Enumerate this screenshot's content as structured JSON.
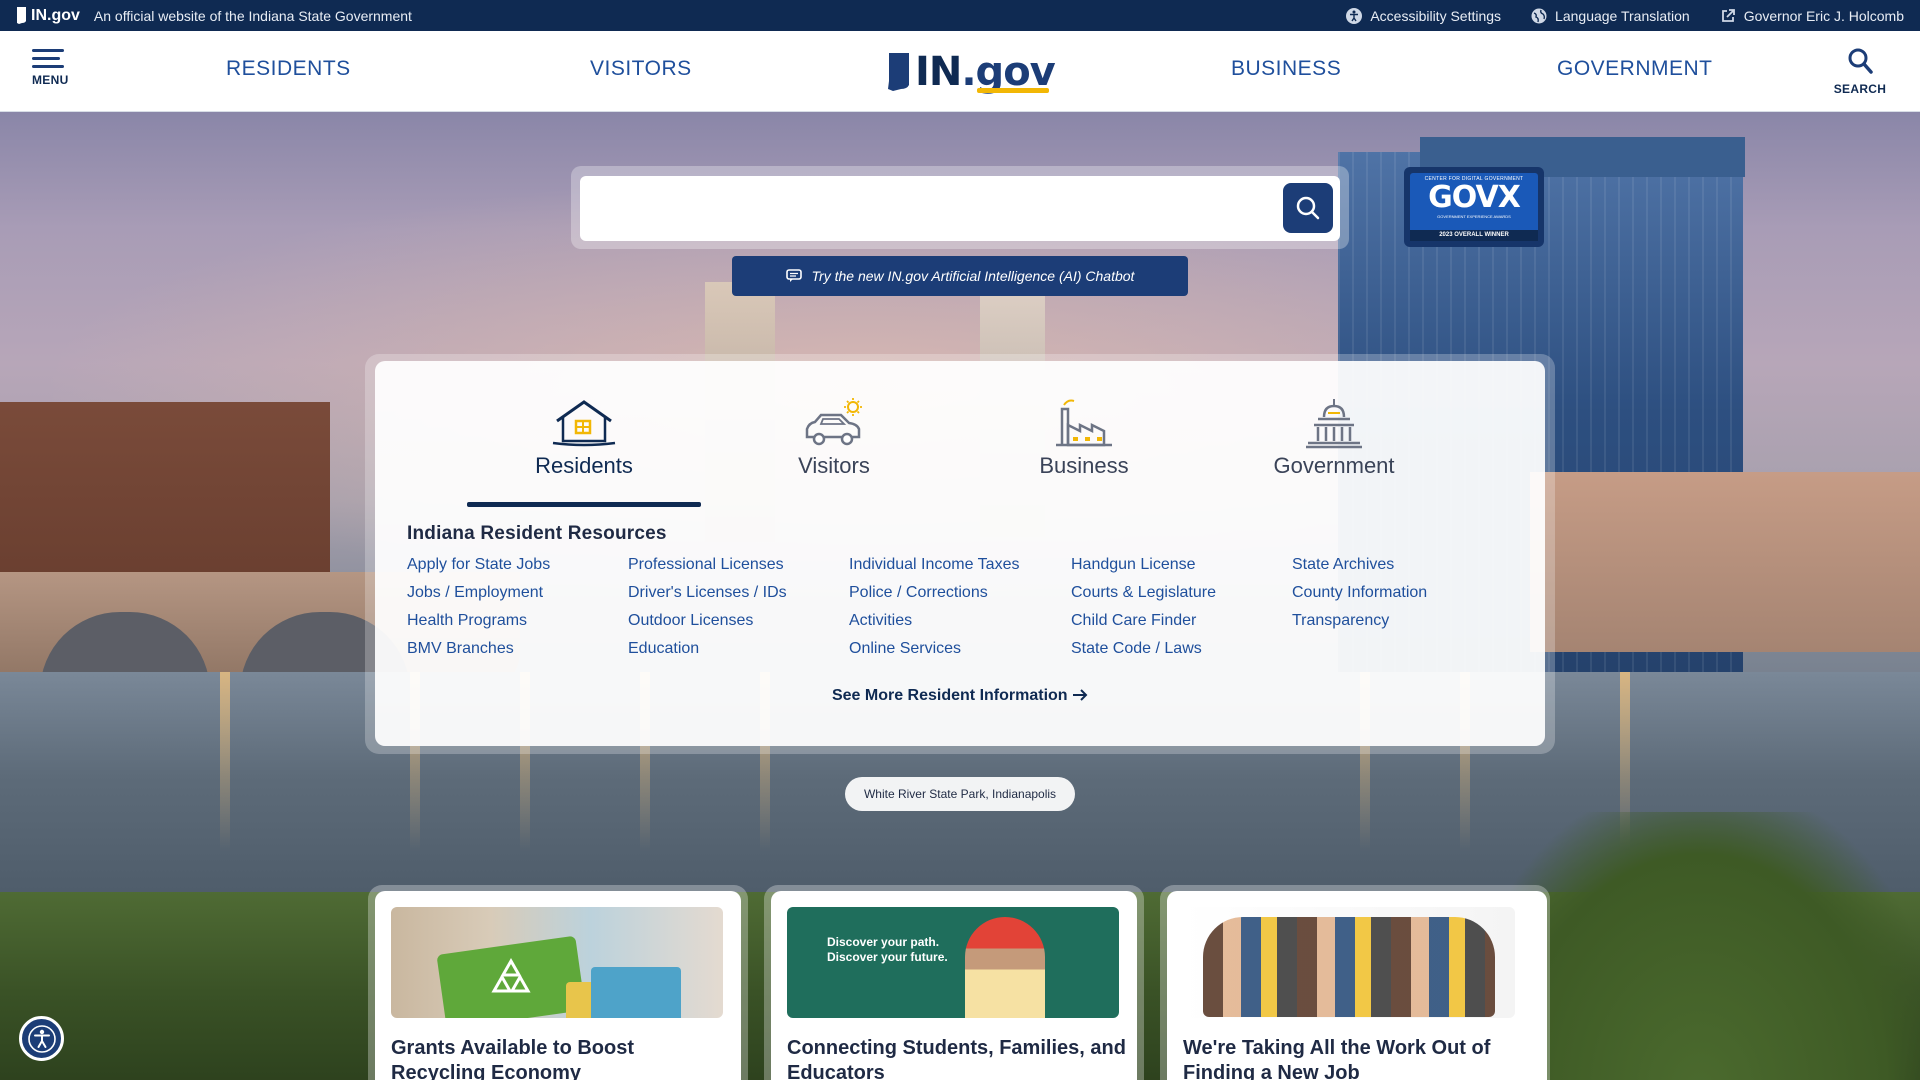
{
  "topbar": {
    "logo_text": "IN.gov",
    "official_text": "An official website of the Indiana State Government",
    "utilities": [
      {
        "label": "Accessibility Settings",
        "icon": "accessibility-icon"
      },
      {
        "label": "Language Translation",
        "icon": "globe-icon"
      },
      {
        "label": "Governor Eric J. Holcomb",
        "icon": "external-link-icon"
      }
    ]
  },
  "nav": {
    "menu_label": "MENU",
    "links": [
      "RESIDENTS",
      "VISITORS",
      "BUSINESS",
      "GOVERNMENT"
    ],
    "brand_in": "IN",
    "brand_gov": ".gov",
    "search_label": "SEARCH"
  },
  "search": {
    "placeholder": "",
    "chatbot_label": "Try the new IN.gov Artificial Intelligence (AI) Chatbot"
  },
  "award": {
    "top": "CENTER FOR DIGITAL GOVERNMENT",
    "big": "GOVX",
    "sub": "GOVERNMENT EXPERIENCE AWARDS",
    "bottom": "2023 OVERALL WINNER"
  },
  "categories": {
    "tabs": [
      {
        "label": "Residents",
        "icon": "house-icon",
        "active": true
      },
      {
        "label": "Visitors",
        "icon": "car-sun-icon",
        "active": false
      },
      {
        "label": "Business",
        "icon": "factory-icon",
        "active": false
      },
      {
        "label": "Government",
        "icon": "capitol-icon",
        "active": false
      }
    ],
    "section_title": "Indiana Resident Resources",
    "links": [
      "Apply for State Jobs",
      "Jobs / Employment",
      "Health Programs",
      "BMV Branches",
      "Professional Licenses",
      "Driver's Licenses / IDs",
      "Outdoor Licenses",
      "Education",
      "Individual Income Taxes",
      "Police / Corrections",
      "Activities",
      "Online Services",
      "Handgun License",
      "Courts & Legislature",
      "Child Care Finder",
      "State Code / Laws",
      "State Archives",
      "County Information",
      "Transparency"
    ],
    "see_more": "See More Resident Information"
  },
  "photo_caption": "White River State Park, Indianapolis",
  "news": [
    {
      "title": "Grants Available to Boost Recycling Economy"
    },
    {
      "title": "Connecting Students, Families, and Educators",
      "image_text": "Discover your path.\nDiscover your future."
    },
    {
      "title": "We're Taking All the Work Out of Finding a New Job"
    }
  ],
  "colors": {
    "navy": "#0f2a52",
    "blue": "#1c3d77",
    "link": "#1f4f9c",
    "gold": "#f2b705"
  }
}
